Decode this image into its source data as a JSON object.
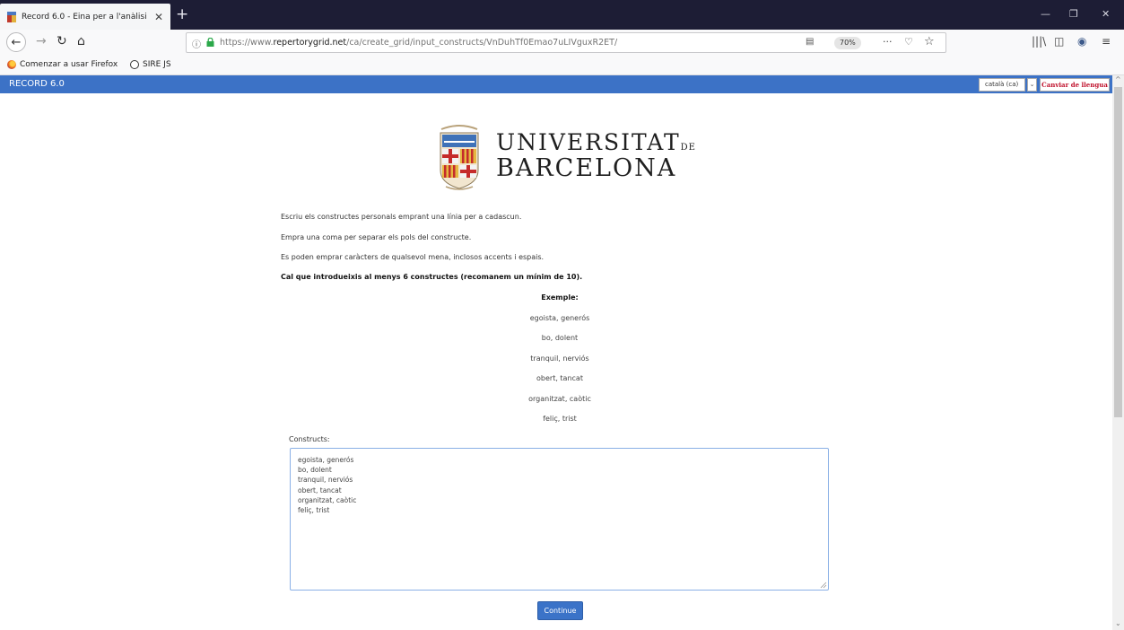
{
  "browser": {
    "tab_title": "Record 6.0 - Eina per a l'anàlisi",
    "tab_close": "✕",
    "new_tab": "+",
    "window_controls": [
      "—",
      "❐",
      "✕"
    ],
    "url_prefix": "https://www.",
    "url_host": "repertorygrid.net",
    "url_path": "/ca/create_grid/input_constructs/VnDuhTf0Emao7uLIVguxR2ET/",
    "zoom_level": "70%",
    "page_actions": "···",
    "bookmarks": [
      "Comenzar a usar Firefox",
      "SIRE JS"
    ]
  },
  "site": {
    "brand": "RECORD 6.0",
    "language_selected": "català (ca)",
    "change_language_label": "Canviar de llengua"
  },
  "logo": {
    "line1": "UNIVERSITAT",
    "line1_suffix": "DE",
    "line2": "BARCELONA"
  },
  "instructions": {
    "p1": "Escriu els constructes personals emprant una línia per a cadascun.",
    "p2": "Empra una coma per separar els pols del constructe.",
    "p3": "Es poden emprar caràcters de qualsevol mena, inclosos accents i espais.",
    "p4": "Cal que introdueixis al menys 6 constructes (recomanem un mínim de 10)."
  },
  "example": {
    "heading": "Exemple:",
    "items": [
      "egoista, generós",
      "bo, dolent",
      "tranquil, nerviós",
      "obert, tancat",
      "organitzat, caòtic",
      "feliç, trist"
    ]
  },
  "form": {
    "constructs_label": "Constructs:",
    "constructs_value": "egoista, generós\nbo, dolent\ntranquil, nerviós\nobert, tancat\norganitzat, caòtic\nfeliç, trist",
    "continue_label": "Continue"
  },
  "colors": {
    "site_bar": "#3c72c6",
    "button": "#3b73c8",
    "tab_strip": "#1d1d35"
  }
}
